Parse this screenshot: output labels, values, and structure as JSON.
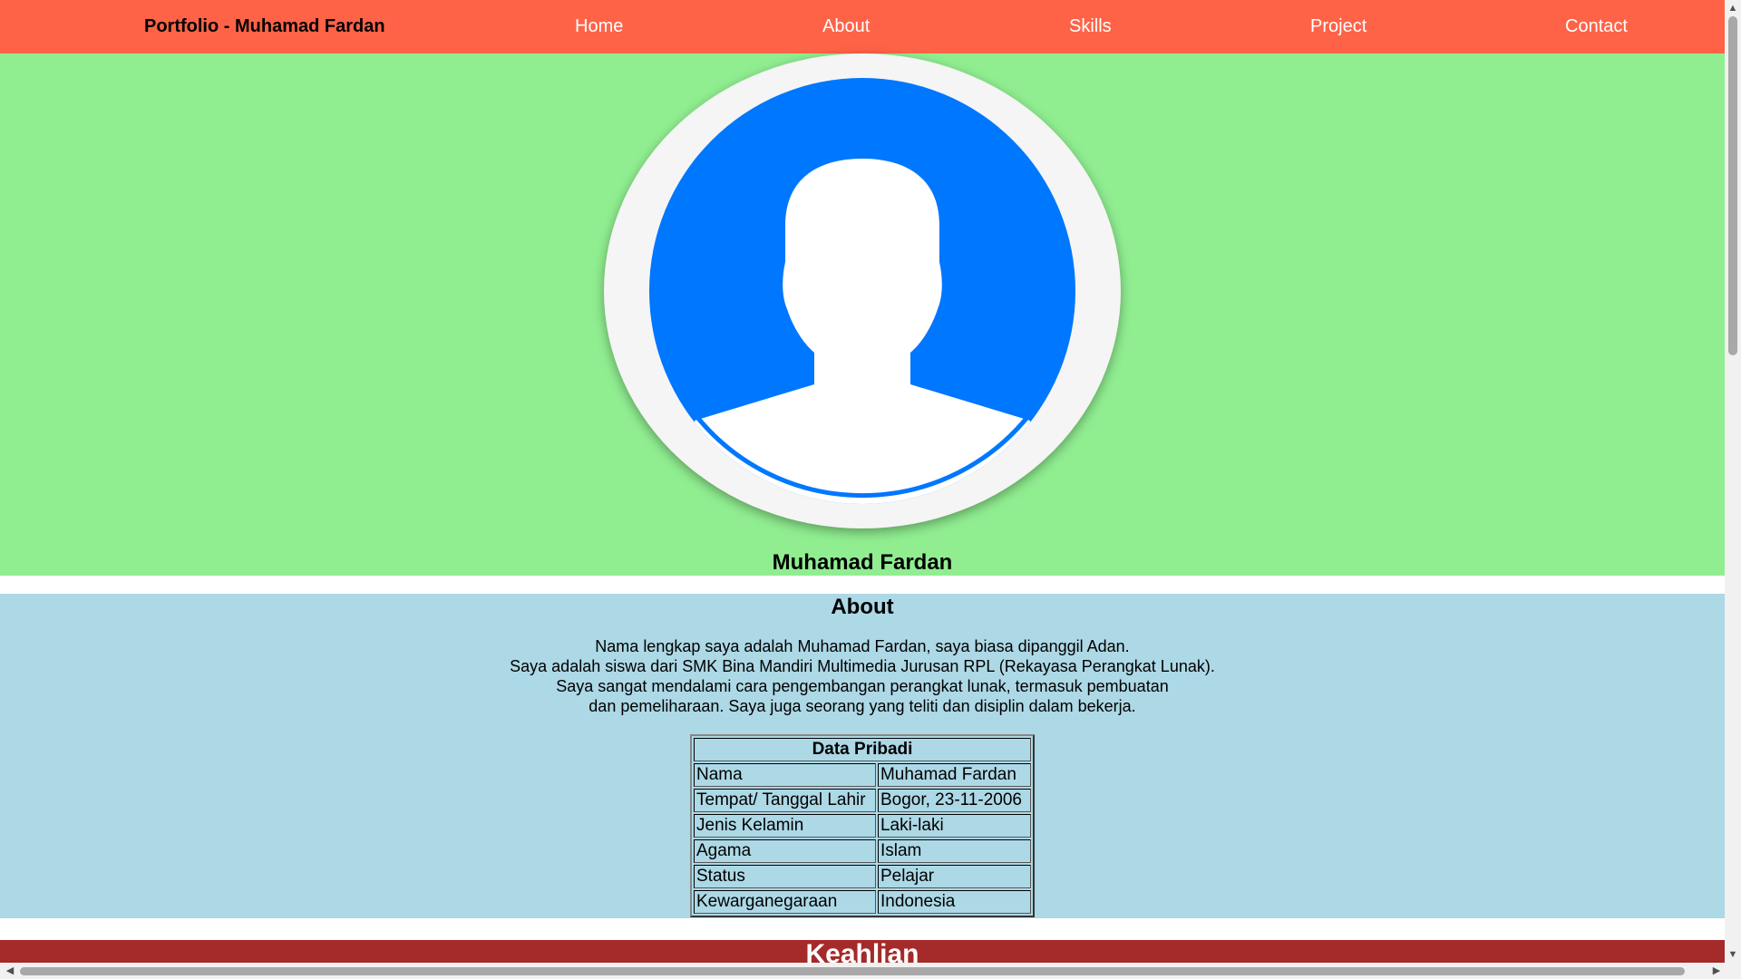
{
  "nav": {
    "brand": "Portfolio - Muhamad Fardan",
    "links": [
      "Home",
      "About",
      "Skills",
      "Project",
      "Contact"
    ]
  },
  "hero": {
    "name": "Muhamad Fardan",
    "avatar_icon": "user-silhouette-icon",
    "colors": {
      "background": "#90ee90",
      "avatar": "#0077ff"
    }
  },
  "about": {
    "title": "About",
    "lines": [
      "Nama lengkap saya adalah Muhamad Fardan, saya biasa dipanggil Adan.",
      "Saya adalah siswa dari SMK Bina Mandiri Multimedia Jurusan RPL (Rekayasa Perangkat Lunak).",
      "Saya sangat mendalami cara pengembangan perangkat lunak, termasuk pembuatan",
      "dan pemeliharaan. Saya juga seorang yang teliti dan disiplin dalam bekerja."
    ],
    "table": {
      "title": "Data Pribadi",
      "rows": [
        [
          "Nama",
          "Muhamad Fardan"
        ],
        [
          "Tempat/ Tanggal Lahir",
          "Bogor, 23-11-2006"
        ],
        [
          "Jenis Kelamin",
          "Laki-laki"
        ],
        [
          "Agama",
          "Islam"
        ],
        [
          "Status",
          "Pelajar"
        ],
        [
          "Kewarganegaraan",
          "Indonesia"
        ]
      ]
    }
  },
  "skills": {
    "title": "Keahlian"
  },
  "colors": {
    "navbar": "#ff6347",
    "about": "#add8e6",
    "skills": "#a52a2a"
  }
}
